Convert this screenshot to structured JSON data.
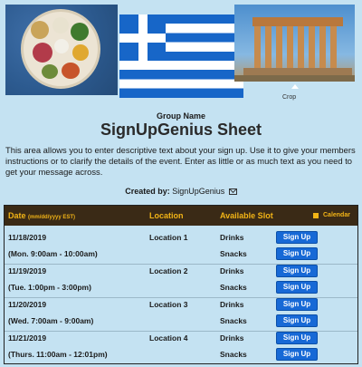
{
  "banner": {
    "crop_label": "Crop"
  },
  "header": {
    "group_name": "Group Name",
    "title": "SignUpGenius Sheet"
  },
  "description": "This area allows you to enter descriptive text about your sign up. Use it to give your members instructions or to clarify the details of the event. Enter as little or as much text as you need to get your message across.",
  "created": {
    "label": "Created by:",
    "name": "SignUpGenius"
  },
  "table": {
    "header": {
      "date": "Date",
      "date_format": "(mm/dd/yyyy  EST)",
      "location": "Location",
      "slot": "Available Slot",
      "calendar": "Calendar"
    },
    "groups": [
      {
        "date": "11/18/2019",
        "time": "(Mon. 9:00am - 10:00am)",
        "location": "Location 1",
        "slots": [
          {
            "name": "Drinks",
            "button": "Sign Up"
          },
          {
            "name": "Snacks",
            "button": "Sign Up"
          }
        ]
      },
      {
        "date": "11/19/2019",
        "time": "(Tue. 1:00pm - 3:00pm)",
        "location": "Location 2",
        "slots": [
          {
            "name": "Drinks",
            "button": "Sign Up"
          },
          {
            "name": "Snacks",
            "button": "Sign Up"
          }
        ]
      },
      {
        "date": "11/20/2019",
        "time": "(Wed. 7:00am - 9:00am)",
        "location": "Location 3",
        "slots": [
          {
            "name": "Drinks",
            "button": "Sign Up"
          },
          {
            "name": "Snacks",
            "button": "Sign Up"
          }
        ]
      },
      {
        "date": "11/21/2019",
        "time": "(Thurs. 11:00am - 12:01pm)",
        "location": "Location 4",
        "slots": [
          {
            "name": "Drinks",
            "button": "Sign Up"
          },
          {
            "name": "Snacks",
            "button": "Sign Up"
          }
        ]
      }
    ]
  },
  "colors": {
    "page_background": "#c4e2f2",
    "header_background": "#3a2a16",
    "header_text": "#f2b416",
    "button": "#1769d6"
  },
  "icons": [
    "envelope-icon",
    "calendar-icon"
  ]
}
